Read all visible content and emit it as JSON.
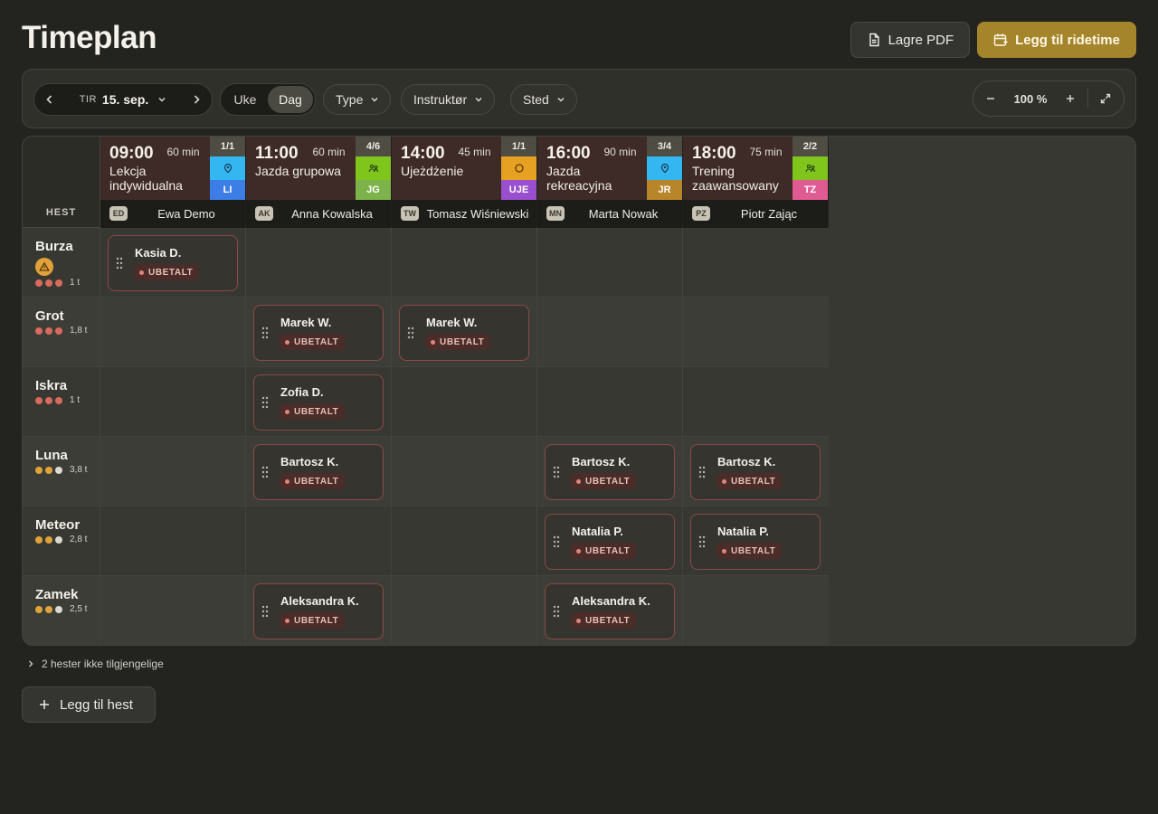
{
  "header": {
    "title": "Timeplan",
    "pdf_label": "Lagre PDF",
    "add_lesson_label": "Legg til ridetime"
  },
  "toolbar": {
    "date_dow": "TIR",
    "date_day": "15. sep.",
    "view_week": "Uke",
    "view_day": "Dag",
    "filters": [
      "Type",
      "Instruktør",
      "Sted"
    ],
    "zoom": "100 %"
  },
  "grid": {
    "corner_label": "HEST"
  },
  "lessons": [
    {
      "time": "09:00",
      "duration": "60 min",
      "title": "Lekcja indywidualna",
      "capacity": "1/1",
      "type_icon": "target-icon",
      "type_color": "#34b6f0",
      "code": "LI",
      "code_color": "#3d7de6",
      "instructor_initials": "ED",
      "instructor": "Ewa Demo"
    },
    {
      "time": "11:00",
      "duration": "60 min",
      "title": "Jazda grupowa",
      "capacity": "4/6",
      "type_icon": "group-icon",
      "type_color": "#7fc51c",
      "code": "JG",
      "code_color": "#7db34a",
      "instructor_initials": "AK",
      "instructor": "Anna Kowalska"
    },
    {
      "time": "14:00",
      "duration": "45 min",
      "title": "Ujeżdżenie",
      "capacity": "1/1",
      "type_icon": "circle-icon",
      "type_color": "#e6a022",
      "code": "UJE",
      "code_color": "#9a4fce",
      "instructor_initials": "TW",
      "instructor": "Tomasz Wiśniewski"
    },
    {
      "time": "16:00",
      "duration": "90 min",
      "title": "Jazda rekreacyjna",
      "capacity": "3/4",
      "type_icon": "target-icon",
      "type_color": "#34b6f0",
      "code": "JR",
      "code_color": "#b8862a",
      "instructor_initials": "MN",
      "instructor": "Marta Nowak"
    },
    {
      "time": "18:00",
      "duration": "75 min",
      "title": "Trening zaawansowany",
      "capacity": "2/2",
      "type_icon": "group-icon",
      "type_color": "#7fc51c",
      "code": "TZ",
      "code_color": "#e15b93",
      "instructor_initials": "PZ",
      "instructor": "Piotr Zając"
    }
  ],
  "horses": [
    {
      "name": "Burza",
      "warning": true,
      "dots": [
        "#d86a5e",
        "#d86a5e",
        "#d86a5e"
      ],
      "load": "1 t"
    },
    {
      "name": "Grot",
      "warning": false,
      "dots": [
        "#d86a5e",
        "#d86a5e",
        "#d86a5e"
      ],
      "load": "1,8 t"
    },
    {
      "name": "Iskra",
      "warning": false,
      "dots": [
        "#d86a5e",
        "#d86a5e",
        "#d86a5e"
      ],
      "load": "1 t"
    },
    {
      "name": "Luna",
      "warning": false,
      "dots": [
        "#e0a33a",
        "#e0a33a",
        "#dcdad3"
      ],
      "load": "3,8 t"
    },
    {
      "name": "Meteor",
      "warning": false,
      "dots": [
        "#e0a33a",
        "#e0a33a",
        "#dcdad3"
      ],
      "load": "2,8 t"
    },
    {
      "name": "Zamek",
      "warning": false,
      "dots": [
        "#e0a33a",
        "#e0a33a",
        "#dcdad3"
      ],
      "load": "2,5 t"
    }
  ],
  "bookings": [
    {
      "horse": 0,
      "lesson": 0,
      "rider": "Kasia D.",
      "status": "UBETALT"
    },
    {
      "horse": 1,
      "lesson": 1,
      "rider": "Marek W.",
      "status": "UBETALT"
    },
    {
      "horse": 1,
      "lesson": 2,
      "rider": "Marek W.",
      "status": "UBETALT"
    },
    {
      "horse": 2,
      "lesson": 1,
      "rider": "Zofia D.",
      "status": "UBETALT"
    },
    {
      "horse": 3,
      "lesson": 1,
      "rider": "Bartosz K.",
      "status": "UBETALT"
    },
    {
      "horse": 3,
      "lesson": 3,
      "rider": "Bartosz K.",
      "status": "UBETALT"
    },
    {
      "horse": 3,
      "lesson": 4,
      "rider": "Bartosz K.",
      "status": "UBETALT"
    },
    {
      "horse": 4,
      "lesson": 3,
      "rider": "Natalia P.",
      "status": "UBETALT"
    },
    {
      "horse": 4,
      "lesson": 4,
      "rider": "Natalia P.",
      "status": "UBETALT"
    },
    {
      "horse": 5,
      "lesson": 1,
      "rider": "Aleksandra K.",
      "status": "UBETALT"
    },
    {
      "horse": 5,
      "lesson": 3,
      "rider": "Aleksandra K.",
      "status": "UBETALT"
    }
  ],
  "footer": {
    "unavailable_label": "2 hester ikke tilgjengelige",
    "add_horse_label": "Legg til hest"
  },
  "colors": {
    "accent": "#a5852c",
    "unpaid": "#e0857a"
  }
}
